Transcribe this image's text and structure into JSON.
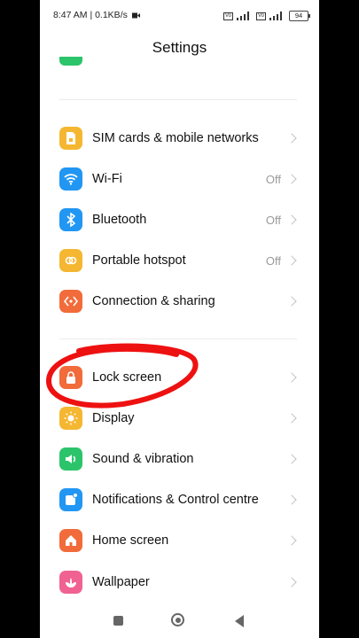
{
  "status_bar": {
    "time_speed": "8:47 AM | 0.1KB/s",
    "camera_icon": "video-icon",
    "battery": "94"
  },
  "header": {
    "title": "Settings"
  },
  "partial_item": {
    "label": "...",
    "icon": "green-icon"
  },
  "groups": [
    {
      "items": [
        {
          "label": "SIM cards & mobile networks",
          "value": "",
          "icon": "sim-card-icon",
          "color": "#f5b731"
        },
        {
          "label": "Wi-Fi",
          "value": "Off",
          "icon": "wifi-icon",
          "color": "#2196f3"
        },
        {
          "label": "Bluetooth",
          "value": "Off",
          "icon": "bluetooth-icon",
          "color": "#2196f3"
        },
        {
          "label": "Portable hotspot",
          "value": "Off",
          "icon": "hotspot-icon",
          "color": "#f5b731"
        },
        {
          "label": "Connection & sharing",
          "value": "",
          "icon": "connection-icon",
          "color": "#f26b3a"
        }
      ]
    },
    {
      "items": [
        {
          "label": "Lock screen",
          "value": "",
          "icon": "lock-icon",
          "color": "#f26b3a"
        },
        {
          "label": "Display",
          "value": "",
          "icon": "sun-icon",
          "color": "#f5b731"
        },
        {
          "label": "Sound & vibration",
          "value": "",
          "icon": "speaker-icon",
          "color": "#2cc46b"
        },
        {
          "label": "Notifications & Control centre",
          "value": "",
          "icon": "notification-icon",
          "color": "#2196f3"
        },
        {
          "label": "Home screen",
          "value": "",
          "icon": "home-icon",
          "color": "#f26b3a"
        },
        {
          "label": "Wallpaper",
          "value": "",
          "icon": "flower-icon",
          "color": "#f06292"
        }
      ]
    }
  ],
  "annotation": {
    "color": "#ee1111"
  },
  "nav": {
    "recents": "square-icon",
    "home": "circle-icon",
    "back": "triangle-back-icon"
  }
}
